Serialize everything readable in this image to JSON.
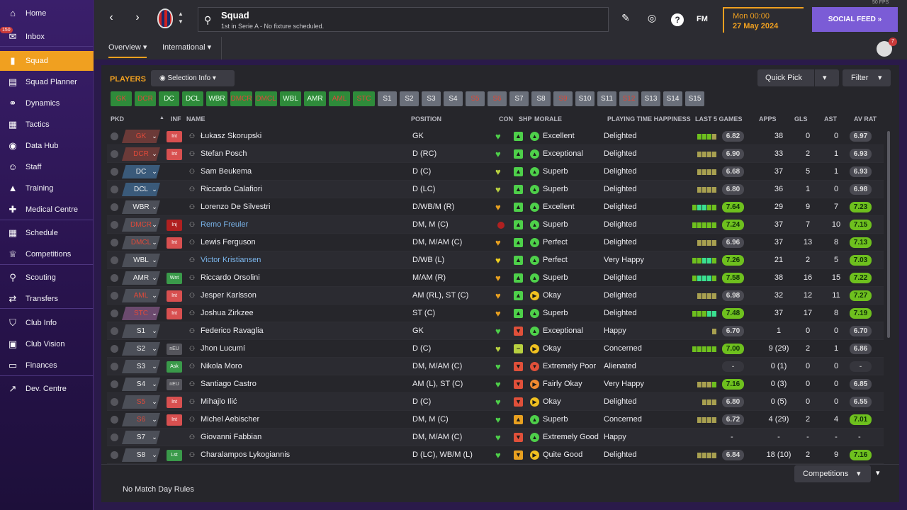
{
  "sidebar": {
    "inbox_badge": "150",
    "items": [
      {
        "label": "Home",
        "icon": "home-icon",
        "glyph": "⌂"
      },
      {
        "label": "Inbox",
        "icon": "inbox-icon",
        "glyph": "✉"
      },
      {
        "label": "Squad",
        "icon": "squad-icon",
        "glyph": "▮"
      },
      {
        "label": "Squad Planner",
        "icon": "planner-icon",
        "glyph": "▤"
      },
      {
        "label": "Dynamics",
        "icon": "dynamics-icon",
        "glyph": "⚭"
      },
      {
        "label": "Tactics",
        "icon": "tactics-icon",
        "glyph": "▦"
      },
      {
        "label": "Data Hub",
        "icon": "data-hub-icon",
        "glyph": "◉"
      },
      {
        "label": "Staff",
        "icon": "staff-icon",
        "glyph": "☺"
      },
      {
        "label": "Training",
        "icon": "training-icon",
        "glyph": "▲"
      },
      {
        "label": "Medical Centre",
        "icon": "medical-icon",
        "glyph": "✚"
      },
      {
        "label": "Schedule",
        "icon": "schedule-icon",
        "glyph": "▦"
      },
      {
        "label": "Competitions",
        "icon": "trophy-icon",
        "glyph": "♕"
      },
      {
        "label": "Scouting",
        "icon": "scouting-icon",
        "glyph": "⚲"
      },
      {
        "label": "Transfers",
        "icon": "transfers-icon",
        "glyph": "⇄"
      },
      {
        "label": "Club Info",
        "icon": "club-info-icon",
        "glyph": "⛉"
      },
      {
        "label": "Club Vision",
        "icon": "club-vision-icon",
        "glyph": "▣"
      },
      {
        "label": "Finances",
        "icon": "finances-icon",
        "glyph": "▭"
      },
      {
        "label": "Dev. Centre",
        "icon": "dev-centre-icon",
        "glyph": "↗"
      }
    ]
  },
  "topbar": {
    "title": "Squad",
    "subtitle": "1st in Serie A - No fixture scheduled.",
    "fm_logo": "FM",
    "time": "Mon 00:00",
    "date": "27 May 2024",
    "social_feed": "SOCIAL FEED",
    "fps": "50 FPS",
    "avatar_badge": "7"
  },
  "subnav": {
    "tabs": [
      "Overview",
      "International"
    ]
  },
  "main": {
    "players_title": "PLAYERS",
    "selection_info": "Selection Info",
    "quick_pick": "Quick Pick",
    "filter": "Filter",
    "chips": [
      {
        "label": "GK",
        "style": "greenred"
      },
      {
        "label": "DCR",
        "style": "greenred"
      },
      {
        "label": "DC",
        "style": "green"
      },
      {
        "label": "DCL",
        "style": "green"
      },
      {
        "label": "WBR",
        "style": "green"
      },
      {
        "label": "DMCR",
        "style": "greenred"
      },
      {
        "label": "DMCL",
        "style": "greenred"
      },
      {
        "label": "WBL",
        "style": "green"
      },
      {
        "label": "AMR",
        "style": "green"
      },
      {
        "label": "AML",
        "style": "greenred"
      },
      {
        "label": "STC",
        "style": "greenred"
      },
      {
        "label": "S1",
        "style": "grey"
      },
      {
        "label": "S2",
        "style": "grey"
      },
      {
        "label": "S3",
        "style": "grey"
      },
      {
        "label": "S4",
        "style": "grey"
      },
      {
        "label": "S5",
        "style": "greyred"
      },
      {
        "label": "S6",
        "style": "greyred"
      },
      {
        "label": "S7",
        "style": "grey"
      },
      {
        "label": "S8",
        "style": "grey"
      },
      {
        "label": "S9",
        "style": "greyred"
      },
      {
        "label": "S10",
        "style": "grey"
      },
      {
        "label": "S11",
        "style": "grey"
      },
      {
        "label": "S12",
        "style": "greyred"
      },
      {
        "label": "S13",
        "style": "grey"
      },
      {
        "label": "S14",
        "style": "grey"
      },
      {
        "label": "S15",
        "style": "grey"
      }
    ],
    "headers": {
      "pkd": "PKD",
      "inf": "INF",
      "name": "NAME",
      "position": "POSITION",
      "con": "CON",
      "shp": "SHP",
      "morale": "MORALE",
      "pth": "PLAYING TIME HAPPINESS",
      "last5": "LAST 5 GAMES",
      "apps": "APPS",
      "gls": "GLS",
      "ast": "AST",
      "avrat": "AV RAT"
    },
    "players": [
      {
        "pkd": "GK",
        "pkd_style": "red",
        "inf": "Int",
        "inf_style": "red",
        "name": "Łukasz Skorupski",
        "link": false,
        "position": "GK",
        "con": "green",
        "shp": "green",
        "morale": "Excellent",
        "mor": "green",
        "pth": "Delighted",
        "form": [
          "g",
          "g",
          "g",
          "o"
        ],
        "last5": "6.82",
        "l5style": "grey",
        "apps": "38",
        "gls": "0",
        "ast": "0",
        "avrat": "6.97",
        "avstyle": "grey"
      },
      {
        "pkd": "DCR",
        "pkd_style": "red",
        "inf": "Int",
        "inf_style": "red",
        "name": "Stefan Posch",
        "link": false,
        "position": "D (RC)",
        "con": "green",
        "shp": "green",
        "morale": "Exceptional",
        "mor": "green",
        "pth": "Delighted",
        "form": [
          "o",
          "o",
          "o",
          "o"
        ],
        "last5": "6.90",
        "l5style": "grey",
        "apps": "33",
        "gls": "2",
        "ast": "1",
        "avrat": "6.93",
        "avstyle": "grey"
      },
      {
        "pkd": "DC",
        "pkd_style": "blue",
        "inf": "",
        "inf_style": "",
        "name": "Sam Beukema",
        "link": false,
        "position": "D (C)",
        "con": "yellowgreen",
        "shp": "green",
        "morale": "Superb",
        "mor": "green",
        "pth": "Delighted",
        "form": [
          "o",
          "o",
          "o",
          "o"
        ],
        "last5": "6.68",
        "l5style": "grey",
        "apps": "37",
        "gls": "5",
        "ast": "1",
        "avrat": "6.93",
        "avstyle": "grey"
      },
      {
        "pkd": "DCL",
        "pkd_style": "blue",
        "inf": "",
        "inf_style": "",
        "name": "Riccardo Calafiori",
        "link": false,
        "position": "D (LC)",
        "con": "yellowgreen",
        "shp": "green",
        "morale": "Superb",
        "mor": "green",
        "pth": "Delighted",
        "form": [
          "o",
          "o",
          "o",
          "o"
        ],
        "last5": "6.80",
        "l5style": "grey",
        "apps": "36",
        "gls": "1",
        "ast": "0",
        "avrat": "6.98",
        "avstyle": "grey"
      },
      {
        "pkd": "WBR",
        "pkd_style": "grey",
        "inf": "",
        "inf_style": "",
        "name": "Lorenzo De Silvestri",
        "link": false,
        "position": "D/WB/M (R)",
        "con": "orange",
        "shp": "green",
        "morale": "Excellent",
        "mor": "green",
        "pth": "Delighted",
        "form": [
          "g",
          "b",
          "b",
          "g",
          "g"
        ],
        "last5": "7.64",
        "l5style": "green",
        "apps": "29",
        "gls": "9",
        "ast": "7",
        "avrat": "7.23",
        "avstyle": "green"
      },
      {
        "pkd": "DMCR",
        "pkd_style": "redgrey",
        "inf": "Inj",
        "inf_style": "darkred",
        "name": "Remo Freuler",
        "link": true,
        "position": "DM, M (C)",
        "con": "reddot",
        "shp": "green",
        "morale": "Superb",
        "mor": "green",
        "pth": "Delighted",
        "form": [
          "g",
          "g",
          "g",
          "g",
          "g"
        ],
        "last5": "7.24",
        "l5style": "green",
        "apps": "37",
        "gls": "7",
        "ast": "10",
        "avrat": "7.15",
        "avstyle": "green"
      },
      {
        "pkd": "DMCL",
        "pkd_style": "redgrey",
        "inf": "Int",
        "inf_style": "red",
        "name": "Lewis Ferguson",
        "link": false,
        "position": "DM, M/AM (C)",
        "con": "orange",
        "shp": "green",
        "morale": "Perfect",
        "mor": "green",
        "pth": "Delighted",
        "form": [
          "o",
          "o",
          "o",
          "o"
        ],
        "last5": "6.96",
        "l5style": "grey",
        "apps": "37",
        "gls": "13",
        "ast": "8",
        "avrat": "7.13",
        "avstyle": "green"
      },
      {
        "pkd": "WBL",
        "pkd_style": "grey",
        "inf": "",
        "inf_style": "",
        "name": "Victor Kristiansen",
        "link": true,
        "position": "D/WB (L)",
        "con": "yellow",
        "shp": "green",
        "morale": "Perfect",
        "mor": "green",
        "pth": "Very Happy",
        "form": [
          "g",
          "g",
          "b",
          "b",
          "g"
        ],
        "last5": "7.26",
        "l5style": "green",
        "apps": "21",
        "gls": "2",
        "ast": "5",
        "avrat": "7.03",
        "avstyle": "green"
      },
      {
        "pkd": "AMR",
        "pkd_style": "grey",
        "inf": "Wnt",
        "inf_style": "green",
        "name": "Riccardo Orsolini",
        "link": false,
        "position": "M/AM (R)",
        "con": "orange",
        "shp": "green",
        "morale": "Superb",
        "mor": "green",
        "pth": "Delighted",
        "form": [
          "g",
          "b",
          "b",
          "b",
          "g"
        ],
        "last5": "7.58",
        "l5style": "green",
        "apps": "38",
        "gls": "16",
        "ast": "15",
        "avrat": "7.22",
        "avstyle": "green"
      },
      {
        "pkd": "AML",
        "pkd_style": "redgrey",
        "inf": "Int",
        "inf_style": "red",
        "name": "Jesper Karlsson",
        "link": false,
        "position": "AM (RL), ST (C)",
        "con": "orange",
        "shp": "green",
        "morale": "Okay",
        "mor": "yellow",
        "pth": "Delighted",
        "form": [
          "o",
          "o",
          "o",
          "o"
        ],
        "last5": "6.98",
        "l5style": "grey",
        "apps": "32",
        "gls": "12",
        "ast": "11",
        "avrat": "7.27",
        "avstyle": "green"
      },
      {
        "pkd": "STC",
        "pkd_style": "purple",
        "inf": "Int",
        "inf_style": "red",
        "name": "Joshua Zirkzee",
        "link": false,
        "position": "ST (C)",
        "con": "orange",
        "shp": "green",
        "morale": "Superb",
        "mor": "green",
        "pth": "Delighted",
        "form": [
          "g",
          "g",
          "g",
          "b",
          "b"
        ],
        "last5": "7.48",
        "l5style": "green",
        "apps": "37",
        "gls": "17",
        "ast": "8",
        "avrat": "7.19",
        "avstyle": "green"
      },
      {
        "pkd": "S1",
        "pkd_style": "grey",
        "inf": "",
        "inf_style": "",
        "name": "Federico Ravaglia",
        "link": false,
        "position": "GK",
        "con": "green",
        "shp": "red",
        "morale": "Exceptional",
        "mor": "green",
        "pth": "Happy",
        "form": [
          "o"
        ],
        "last5": "6.70",
        "l5style": "grey",
        "apps": "1",
        "gls": "0",
        "ast": "0",
        "avrat": "6.70",
        "avstyle": "grey"
      },
      {
        "pkd": "S2",
        "pkd_style": "grey",
        "inf": "nEU",
        "inf_style": "grey",
        "name": "Jhon Lucumí",
        "link": false,
        "position": "D (C)",
        "con": "yellowgreen",
        "shp": "yellow",
        "morale": "Okay",
        "mor": "yellow",
        "pth": "Concerned",
        "form": [
          "g",
          "g",
          "g",
          "g",
          "g"
        ],
        "last5": "7.00",
        "l5style": "green",
        "apps": "9 (29)",
        "gls": "2",
        "ast": "1",
        "avrat": "6.86",
        "avstyle": "grey"
      },
      {
        "pkd": "S3",
        "pkd_style": "grey",
        "inf": "Ask",
        "inf_style": "green",
        "name": "Nikola Moro",
        "link": false,
        "position": "DM, M/AM (C)",
        "con": "green",
        "shp": "red",
        "morale": "Extremely Poor",
        "mor": "red",
        "pth": "Alienated",
        "form": [],
        "last5": "-",
        "l5style": "dash",
        "apps": "0 (1)",
        "gls": "0",
        "ast": "0",
        "avrat": "-",
        "avstyle": "dash"
      },
      {
        "pkd": "S4",
        "pkd_style": "grey",
        "inf": "nEU",
        "inf_style": "grey",
        "name": "Santiago Castro",
        "link": false,
        "position": "AM (L), ST (C)",
        "con": "green",
        "shp": "red",
        "morale": "Fairly Okay",
        "mor": "orange",
        "pth": "Very Happy",
        "form": [
          "o",
          "o",
          "o",
          "g"
        ],
        "last5": "7.16",
        "l5style": "green",
        "apps": "0 (3)",
        "gls": "0",
        "ast": "0",
        "avrat": "6.85",
        "avstyle": "grey"
      },
      {
        "pkd": "S5",
        "pkd_style": "redgrey",
        "inf": "Int",
        "inf_style": "red",
        "name": "Mihajlo Ilić",
        "link": false,
        "position": "D (C)",
        "con": "green",
        "shp": "red",
        "morale": "Okay",
        "mor": "yellow",
        "pth": "Delighted",
        "form": [
          "o",
          "o",
          "o"
        ],
        "last5": "6.80",
        "l5style": "grey",
        "apps": "0 (5)",
        "gls": "0",
        "ast": "0",
        "avrat": "6.55",
        "avstyle": "grey"
      },
      {
        "pkd": "S6",
        "pkd_style": "redgrey",
        "inf": "Int",
        "inf_style": "red",
        "name": "Michel Aebischer",
        "link": false,
        "position": "DM, M (C)",
        "con": "green",
        "shp": "orangeup",
        "morale": "Superb",
        "mor": "green",
        "pth": "Concerned",
        "form": [
          "o",
          "o",
          "o",
          "o"
        ],
        "last5": "6.72",
        "l5style": "grey",
        "apps": "4 (29)",
        "gls": "2",
        "ast": "4",
        "avrat": "7.01",
        "avstyle": "green"
      },
      {
        "pkd": "S7",
        "pkd_style": "grey",
        "inf": "",
        "inf_style": "",
        "name": "Giovanni Fabbian",
        "link": false,
        "position": "DM, M/AM (C)",
        "con": "green",
        "shp": "red",
        "morale": "Extremely Good",
        "mor": "green",
        "pth": "Happy",
        "form": [],
        "last5": "-",
        "l5style": "none",
        "apps": "-",
        "gls": "-",
        "ast": "-",
        "avrat": "-",
        "avstyle": "none"
      },
      {
        "pkd": "S8",
        "pkd_style": "grey",
        "inf": "Lst",
        "inf_style": "green",
        "name": "Charalampos Lykogiannis",
        "link": false,
        "position": "D (LC), WB/M (L)",
        "con": "green",
        "shp": "orange",
        "morale": "Quite Good",
        "mor": "yellow",
        "pth": "Delighted",
        "form": [
          "o",
          "o",
          "o",
          "o"
        ],
        "last5": "6.84",
        "l5style": "grey",
        "apps": "18 (10)",
        "gls": "2",
        "ast": "9",
        "avrat": "7.16",
        "avstyle": "green"
      }
    ],
    "competitions": "Competitions",
    "no_match_rules": "No Match Day Rules"
  },
  "colors": {
    "accent": "#f0a020",
    "social": "#7b5cd6",
    "rating_green": "#6ec01e"
  }
}
